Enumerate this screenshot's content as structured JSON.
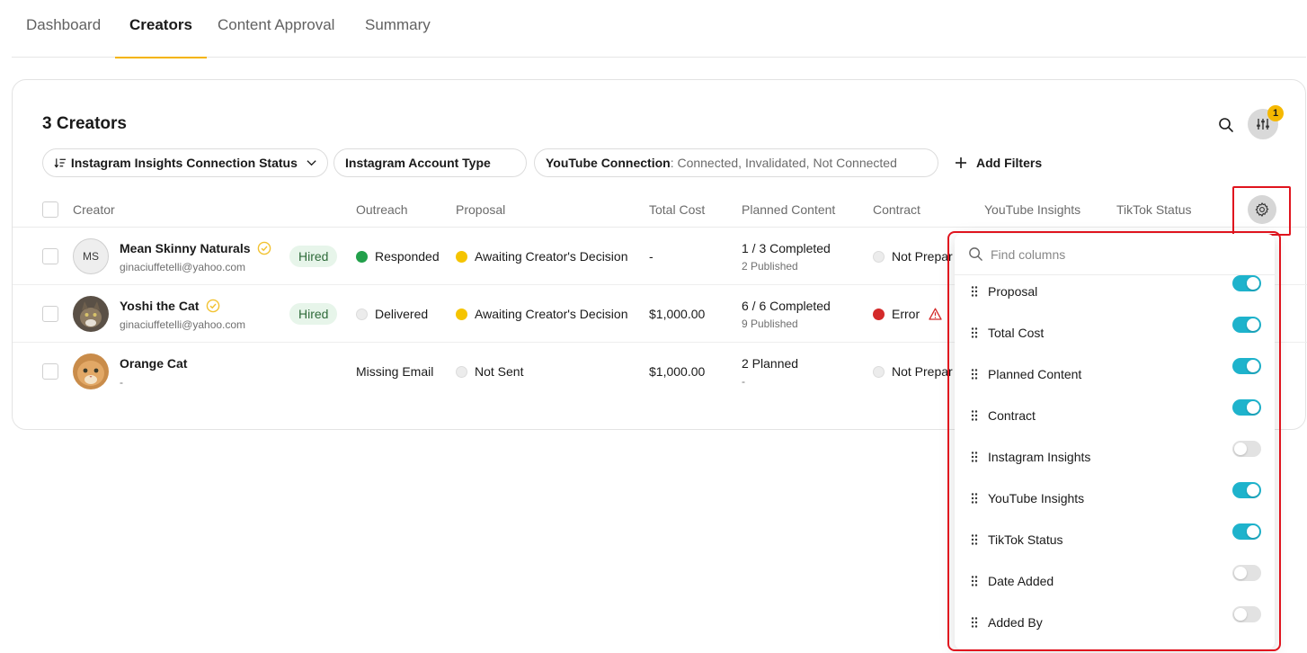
{
  "tabs": [
    {
      "label": "Dashboard"
    },
    {
      "label": "Creators"
    },
    {
      "label": "Content Approval"
    },
    {
      "label": "Summary"
    }
  ],
  "active_tab": "Creators",
  "card": {
    "title": "3 Creators",
    "filter_badge": "1"
  },
  "filters": {
    "chip1": "Instagram Insights Connection Status",
    "chip2": "Instagram Account Type",
    "chip3_key": "YouTube Connection",
    "chip3_value": ": Connected, Invalidated, Not Connected",
    "add_filters": "Add Filters"
  },
  "table": {
    "headers": {
      "creator": "Creator",
      "outreach": "Outreach",
      "proposal": "Proposal",
      "total_cost": "Total Cost",
      "planned_content": "Planned Content",
      "contract": "Contract",
      "youtube_insights": "YouTube Insights",
      "tiktok_status": "TikTok Status"
    },
    "rows": [
      {
        "initials": "MS",
        "name": "Mean Skinny Naturals",
        "email": "ginaciuffetelli@yahoo.com",
        "status": "Hired",
        "outreach": "Responded",
        "proposal": "Awaiting Creator's Decision",
        "total_cost": "-",
        "planned": "1 / 3 Completed",
        "planned_sub": "2 Published",
        "contract": "Not Prepar"
      },
      {
        "name": "Yoshi the Cat",
        "email": "ginaciuffetelli@yahoo.com",
        "status": "Hired",
        "outreach": "Delivered",
        "proposal": "Awaiting Creator's Decision",
        "total_cost": "$1,000.00",
        "planned": "6 / 6 Completed",
        "planned_sub": "9 Published",
        "contract": "Error"
      },
      {
        "name": "Orange Cat",
        "email": "-",
        "outreach": "Missing Email",
        "proposal": "Not Sent",
        "total_cost": "$1,000.00",
        "planned": "2 Planned",
        "planned_sub": "-",
        "contract": "Not Prepar"
      }
    ]
  },
  "column_panel": {
    "search_placeholder": "Find columns",
    "columns": [
      {
        "label": "Proposal",
        "enabled": true
      },
      {
        "label": "Total Cost",
        "enabled": true
      },
      {
        "label": "Planned Content",
        "enabled": true
      },
      {
        "label": "Contract",
        "enabled": true
      },
      {
        "label": "Instagram Insights",
        "enabled": false
      },
      {
        "label": "YouTube Insights",
        "enabled": true
      },
      {
        "label": "TikTok Status",
        "enabled": true
      },
      {
        "label": "Date Added",
        "enabled": false
      },
      {
        "label": "Added By",
        "enabled": false
      }
    ]
  },
  "colors": {
    "accent_tab": "#f4b400",
    "toggle_on": "#1eb3cc",
    "highlight": "#e0141e",
    "hired_bg": "#e7f5ea"
  }
}
